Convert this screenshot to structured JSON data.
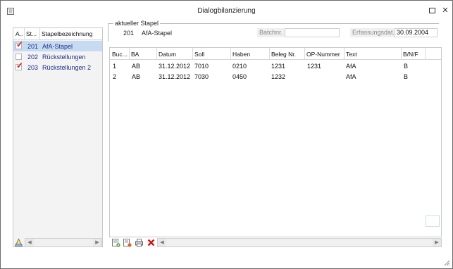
{
  "window": {
    "title": "Dialogbilanzierung"
  },
  "stapel_list": {
    "headers": [
      "A..",
      "St...",
      "Stapelbezeichnung"
    ],
    "rows": [
      {
        "checked": true,
        "number": "201",
        "name": "AfA-Stapel",
        "selected": true
      },
      {
        "checked": false,
        "number": "202",
        "name": "Rückstellungen",
        "selected": false
      },
      {
        "checked": true,
        "number": "203",
        "name": "Rückstellungen 2",
        "selected": false
      }
    ]
  },
  "current_batch": {
    "group_label": "aktueller Stapel",
    "number": "201",
    "name": "AfA-Stapel",
    "batch_label": "Batchnr.",
    "batch_value": "",
    "date_label": "Erfassungsdat.",
    "date_value": "30.09.2004"
  },
  "grid": {
    "headers": [
      "Buc...",
      "BA",
      "Datum",
      "Soll",
      "Haben",
      "Beleg Nr.",
      "OP-Nummer",
      "Text",
      "B/N/F"
    ],
    "rows": [
      [
        "1",
        "AB",
        "31.12.2012",
        "7010",
        "0210",
        "1231",
        "1231",
        "AfA",
        "B"
      ],
      [
        "2",
        "AB",
        "31.12.2012",
        "7030",
        "0450",
        "1232",
        "",
        "AfA",
        "B"
      ]
    ]
  },
  "icons": {
    "app": "document-icon",
    "left_tool": "stapel-tool-icon",
    "grid_tools": [
      "add-row-icon",
      "edit-row-icon",
      "print-icon",
      "delete-icon"
    ]
  },
  "colors": {
    "selection": "#c6daf2",
    "list_text": "#1f2f86",
    "check_mark": "#d11111",
    "delete": "#d11111"
  }
}
